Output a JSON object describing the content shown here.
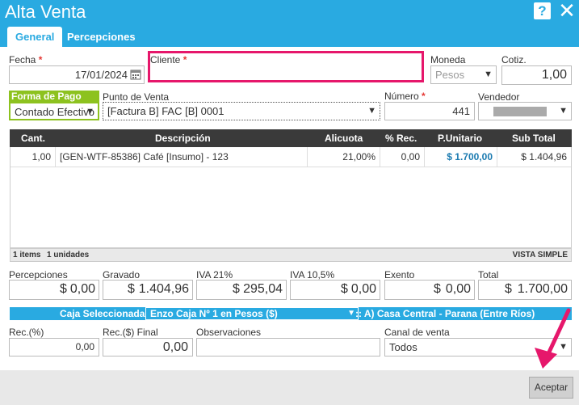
{
  "window": {
    "title": "Alta Venta",
    "help_glyph": "?",
    "close_glyph": "✕"
  },
  "tabs": [
    {
      "label": "General",
      "active": true
    },
    {
      "label": "Percepciones",
      "active": false
    }
  ],
  "form": {
    "fecha": {
      "label": "Fecha",
      "value": "17/01/2024"
    },
    "cliente": {
      "label": "Cliente",
      "value": ""
    },
    "moneda": {
      "label": "Moneda",
      "value": "Pesos"
    },
    "cotiz": {
      "label": "Cotiz.",
      "value": "1,00"
    },
    "forma_pago": {
      "label": "Forma de Pago",
      "value": "Contado Efectivo"
    },
    "punto_venta": {
      "label": "Punto de Venta",
      "value": "[Factura B] FAC [B] 0001"
    },
    "numero": {
      "label": "Número",
      "value": "441"
    },
    "vendedor": {
      "label": "Vendedor",
      "value": ""
    }
  },
  "table": {
    "columns": [
      "Cant.",
      "Descripción",
      "Alicuota",
      "% Rec.",
      "P.Unitario",
      "Sub Total"
    ],
    "rows": [
      {
        "cant": "1,00",
        "descripcion": "[GEN-WTF-85386] Café [Insumo] - 123",
        "alicuota": "21,00%",
        "rec": "0,00",
        "punitario": "$ 1.700,00",
        "subtotal": "$ 1.404,96"
      }
    ],
    "footer_items": "1 items",
    "footer_units": "1 unidades",
    "footer_view": "VISTA SIMPLE"
  },
  "totals": {
    "percepciones": {
      "label": "Percepciones",
      "symbol": "$",
      "value": "0,00"
    },
    "gravado": {
      "label": "Gravado",
      "symbol": "$",
      "value": "1.404,96"
    },
    "iva21": {
      "label": "IVA 21%",
      "symbol": "$",
      "value": "295,04"
    },
    "iva105": {
      "label": "IVA 10,5%",
      "symbol": "$",
      "value": "0,00"
    },
    "exento": {
      "label": "Exento",
      "symbol": "$",
      "value": "0,00"
    },
    "total": {
      "label": "Total",
      "symbol": "$",
      "value": "1.700,00"
    }
  },
  "caja": {
    "label": "Caja Seleccionada:",
    "value": "Enzo Caja Nº 1 en Pesos ($)",
    "sucursal": ":: A) Casa Central - Parana (Entre Ríos)"
  },
  "bottom": {
    "rec_pct": {
      "label": "Rec.(%)",
      "value": "0,00"
    },
    "rec_final": {
      "label": "Rec.($) Final",
      "value": "0,00"
    },
    "observaciones": {
      "label": "Observaciones",
      "value": ""
    },
    "canal": {
      "label": "Canal de venta",
      "value": "Todos"
    }
  },
  "actions": {
    "accept_label": "Aceptar"
  },
  "colors": {
    "accent": "#29aae1",
    "highlight": "#e6176b",
    "price": "#1a7ab0",
    "forma_pago": "#8dc21f"
  }
}
